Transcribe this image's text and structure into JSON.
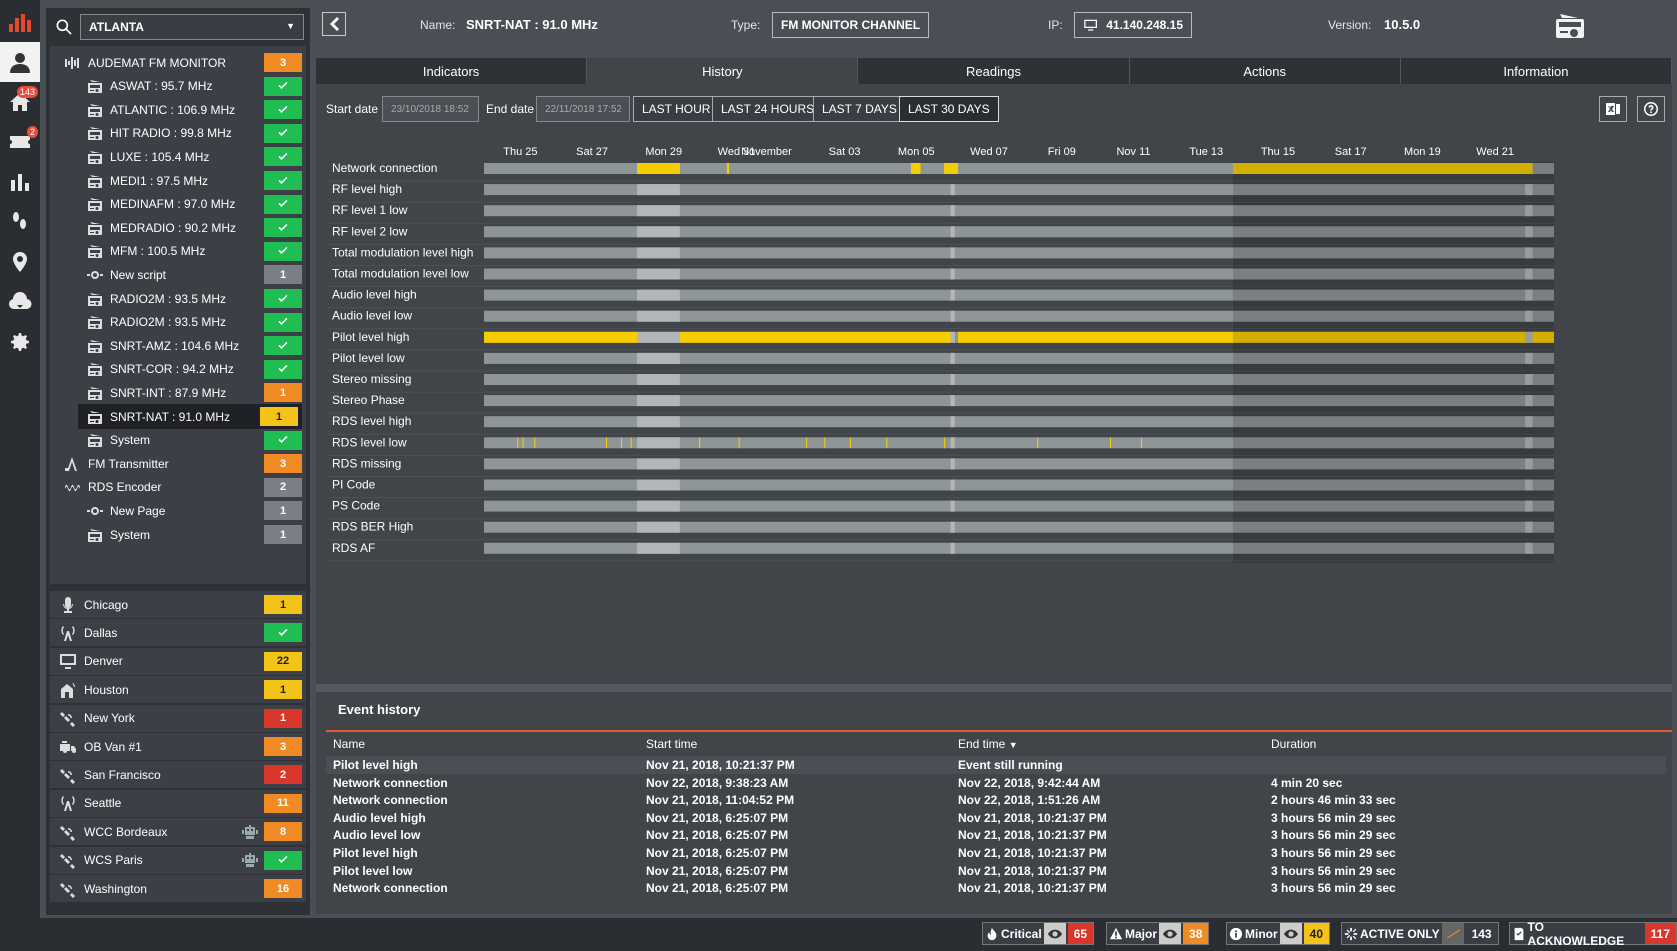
{
  "rail": {
    "home_badge": "143",
    "ticket_badge": "2"
  },
  "sidebar": {
    "search_value": "ATLANTA",
    "tree": [
      {
        "label": "AUDEMAT FM MONITOR",
        "icon": "monitor-wave-icon",
        "level": 1,
        "badge": "3",
        "status": "orange"
      },
      {
        "label": "ASWAT : 95.7 MHz",
        "icon": "radio-icon",
        "level": 2,
        "badge": "",
        "status": "green"
      },
      {
        "label": "ATLANTIC : 106.9 MHz",
        "icon": "radio-icon",
        "level": 2,
        "badge": "",
        "status": "green"
      },
      {
        "label": "HIT RADIO : 99.8 MHz",
        "icon": "radio-icon",
        "level": 2,
        "badge": "",
        "status": "green"
      },
      {
        "label": "LUXE : 105.4 MHz",
        "icon": "radio-icon",
        "level": 2,
        "badge": "",
        "status": "green"
      },
      {
        "label": "MEDI1 : 97.5 MHz",
        "icon": "radio-icon",
        "level": 2,
        "badge": "",
        "status": "green"
      },
      {
        "label": "MEDINAFM : 97.0 MHz",
        "icon": "radio-icon",
        "level": 2,
        "badge": "",
        "status": "green"
      },
      {
        "label": "MEDRADIO : 90.2 MHz",
        "icon": "radio-icon",
        "level": 2,
        "badge": "",
        "status": "green"
      },
      {
        "label": "MFM : 100.5 MHz",
        "icon": "radio-icon",
        "level": 2,
        "badge": "",
        "status": "green"
      },
      {
        "label": "New script",
        "icon": "script-icon",
        "level": 2,
        "badge": "1",
        "status": "gray"
      },
      {
        "label": "RADIO2M : 93.5 MHz",
        "icon": "radio-icon",
        "level": 2,
        "badge": "",
        "status": "green"
      },
      {
        "label": "RADIO2M : 93.5 MHz",
        "icon": "radio-icon",
        "level": 2,
        "badge": "",
        "status": "green"
      },
      {
        "label": "SNRT-AMZ : 104.6 MHz",
        "icon": "radio-icon",
        "level": 2,
        "badge": "",
        "status": "green"
      },
      {
        "label": "SNRT-COR : 94.2 MHz",
        "icon": "radio-icon",
        "level": 2,
        "badge": "",
        "status": "green"
      },
      {
        "label": "SNRT-INT : 87.9 MHz",
        "icon": "radio-icon",
        "level": 2,
        "badge": "1",
        "status": "orange"
      },
      {
        "label": "SNRT-NAT : 91.0 MHz",
        "icon": "radio-icon",
        "level": 2,
        "badge": "1",
        "status": "yellow",
        "selected": true
      },
      {
        "label": "System",
        "icon": "radio-icon",
        "level": 2,
        "badge": "",
        "status": "green"
      },
      {
        "label": "FM Transmitter",
        "icon": "transmitter-icon",
        "level": 1,
        "badge": "3",
        "status": "orange"
      },
      {
        "label": "RDS Encoder",
        "icon": "encoder-icon",
        "level": 1,
        "badge": "2",
        "status": "gray"
      },
      {
        "label": "New Page",
        "icon": "script-icon",
        "level": 2,
        "badge": "1",
        "status": "gray"
      },
      {
        "label": "System",
        "icon": "radio-icon",
        "level": 2,
        "badge": "1",
        "status": "gray"
      }
    ],
    "sites": [
      {
        "label": "Chicago",
        "icon": "microphone-icon",
        "badge": "1",
        "status": "yellow",
        "robot": false
      },
      {
        "label": "Dallas",
        "icon": "antenna-icon",
        "badge": "",
        "status": "green",
        "robot": false
      },
      {
        "label": "Denver",
        "icon": "display-icon",
        "badge": "22",
        "status": "yellow",
        "robot": false
      },
      {
        "label": "Houston",
        "icon": "antenna-house-icon",
        "badge": "1",
        "status": "yellow",
        "robot": false
      },
      {
        "label": "New York",
        "icon": "satellite-icon",
        "badge": "1",
        "status": "red",
        "robot": false
      },
      {
        "label": "OB Van #1",
        "icon": "van-icon",
        "badge": "3",
        "status": "orange",
        "robot": false
      },
      {
        "label": "San Francisco",
        "icon": "satellite-icon",
        "badge": "2",
        "status": "red",
        "robot": false
      },
      {
        "label": "Seattle",
        "icon": "antenna-icon",
        "badge": "11",
        "status": "orange",
        "robot": false
      },
      {
        "label": "WCC Bordeaux",
        "icon": "satellite-icon",
        "badge": "8",
        "status": "orange",
        "robot": true
      },
      {
        "label": "WCS Paris",
        "icon": "satellite-icon",
        "badge": "",
        "status": "green",
        "robot": true
      },
      {
        "label": "Washington",
        "icon": "satellite-icon",
        "badge": "16",
        "status": "orange",
        "robot": false
      }
    ]
  },
  "header": {
    "name_label": "Name:",
    "name_value": "SNRT-NAT : 91.0 MHz",
    "type_label": "Type:",
    "type_value": "FM MONITOR CHANNEL",
    "ip_label": "IP:",
    "ip_value": "41.140.248.15",
    "version_label": "Version:",
    "version_value": "10.5.0"
  },
  "tabs": [
    "Indicators",
    "History",
    "Readings",
    "Actions",
    "Information"
  ],
  "active_tab": 1,
  "filters": {
    "start_label": "Start date",
    "start_value": "23/10/2018 18:52",
    "end_label": "End date",
    "end_value": "22/11/2018 17:52",
    "ranges": [
      "LAST HOUR",
      "LAST 24 HOURS",
      "LAST 7 DAYS",
      "LAST 30 DAYS"
    ],
    "active_range": 3
  },
  "timeline": {
    "day_labels": [
      "Thu 25",
      "Sat 27",
      "Mon 29",
      "Wed 31",
      "November",
      "Sat 03",
      "Mon 05",
      "Wed 07",
      "Fri 09",
      "Nov 11",
      "Tue 13",
      "Thu 15",
      "Sat 17",
      "Mon 19",
      "Wed 21"
    ],
    "day_positions": [
      0.034,
      0.101,
      0.168,
      0.236,
      0.264,
      0.337,
      0.404,
      0.472,
      0.54,
      0.607,
      0.675,
      0.742,
      0.81,
      0.877,
      0.945
    ],
    "active_color": "#f5cc00",
    "idle_color": "#8e9695",
    "gap_color": "#b2b6b6",
    "future_shade_from": 0.7,
    "gaps": [
      [
        0.143,
        0.183
      ],
      [
        0.436,
        0.44
      ],
      [
        0.973,
        0.98
      ]
    ],
    "rows": [
      {
        "label": "Network connection",
        "events": [
          [
            0.143,
            0.183
          ],
          [
            0.227,
            0.229
          ],
          [
            0.399,
            0.408
          ],
          [
            0.43,
            0.443
          ],
          [
            0.7,
            0.973
          ],
          [
            0.973,
            0.98
          ]
        ]
      },
      {
        "label": "RF level high",
        "events": []
      },
      {
        "label": "RF level 1 low",
        "events": []
      },
      {
        "label": "RF level 2 low",
        "events": []
      },
      {
        "label": "Total modulation level high",
        "events": []
      },
      {
        "label": "Total modulation level low",
        "events": []
      },
      {
        "label": "Audio level high",
        "events": []
      },
      {
        "label": "Audio level low",
        "events": []
      },
      {
        "label": "Pilot level high",
        "events": [
          [
            0.0,
            0.143
          ],
          [
            0.183,
            0.436
          ],
          [
            0.443,
            0.973
          ],
          [
            0.98,
            1.0
          ]
        ]
      },
      {
        "label": "Pilot level low",
        "events": []
      },
      {
        "label": "Stereo missing",
        "events": []
      },
      {
        "label": "Stereo Phase",
        "events": []
      },
      {
        "label": "RDS level high",
        "events": []
      },
      {
        "label": "RDS level low",
        "events": [
          [
            0.031,
            0.032
          ],
          [
            0.036,
            0.037
          ],
          [
            0.047,
            0.048
          ],
          [
            0.114,
            0.115
          ],
          [
            0.128,
            0.129
          ],
          [
            0.137,
            0.138
          ],
          [
            0.201,
            0.202
          ],
          [
            0.238,
            0.239
          ],
          [
            0.301,
            0.302
          ],
          [
            0.318,
            0.319
          ],
          [
            0.342,
            0.343
          ],
          [
            0.376,
            0.377
          ],
          [
            0.43,
            0.431
          ],
          [
            0.517,
            0.518
          ],
          [
            0.585,
            0.586
          ],
          [
            0.614,
            0.615
          ]
        ]
      },
      {
        "label": "RDS missing",
        "events": []
      },
      {
        "label": "PI Code",
        "events": []
      },
      {
        "label": "PS Code",
        "events": []
      },
      {
        "label": "RDS BER High",
        "events": []
      },
      {
        "label": "RDS AF",
        "events": []
      }
    ]
  },
  "events": {
    "title": "Event history",
    "columns": [
      "Name",
      "Start time",
      "End time",
      "Duration"
    ],
    "rows": [
      [
        "Pilot level high",
        "Nov 21, 2018, 10:21:37 PM",
        "Event still running",
        ""
      ],
      [
        "Network connection",
        "Nov 22, 2018, 9:38:23 AM",
        "Nov 22, 2018, 9:42:44 AM",
        "4 min 20 sec"
      ],
      [
        "Network connection",
        "Nov 21, 2018, 11:04:52 PM",
        "Nov 22, 2018, 1:51:26 AM",
        "2 hours 46 min 33 sec"
      ],
      [
        "Audio level high",
        "Nov 21, 2018, 6:25:07 PM",
        "Nov 21, 2018, 10:21:37 PM",
        "3 hours 56 min 29 sec"
      ],
      [
        "Audio level low",
        "Nov 21, 2018, 6:25:07 PM",
        "Nov 21, 2018, 10:21:37 PM",
        "3 hours 56 min 29 sec"
      ],
      [
        "Pilot level high",
        "Nov 21, 2018, 6:25:07 PM",
        "Nov 21, 2018, 10:21:37 PM",
        "3 hours 56 min 29 sec"
      ],
      [
        "Pilot level low",
        "Nov 21, 2018, 6:25:07 PM",
        "Nov 21, 2018, 10:21:37 PM",
        "3 hours 56 min 29 sec"
      ],
      [
        "Network connection",
        "Nov 21, 2018, 6:25:07 PM",
        "Nov 21, 2018, 10:21:37 PM",
        "3 hours 56 min 29 sec"
      ]
    ]
  },
  "status_bar": {
    "critical_label": "Critical",
    "critical_count": "65",
    "major_label": "Major",
    "major_count": "38",
    "minor_label": "Minor",
    "minor_count": "40",
    "active_label": "ACTIVE ONLY",
    "active_count": "143",
    "ack_label": "TO ACKNOWLEDGE",
    "ack_count": "117",
    "colors": {
      "critical": "#d9372b",
      "major": "#f08a24",
      "minor": "#f3c318"
    }
  }
}
